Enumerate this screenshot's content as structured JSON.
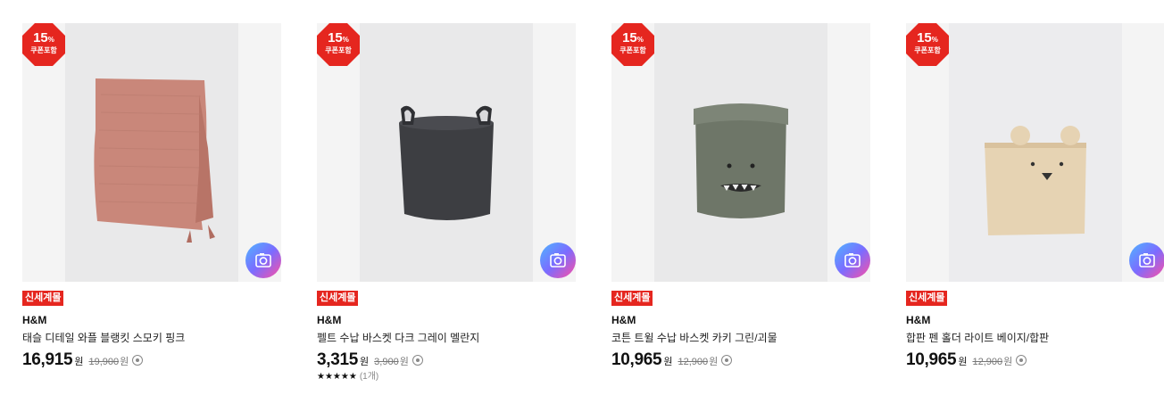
{
  "products": [
    {
      "discount_pct": "15",
      "discount_unit": "%",
      "coupon_label": "쿠폰포함",
      "tag": "신세계몰",
      "brand": "H&M",
      "name": "태슬 디테일 와플 블랭킷 스모키 핑크",
      "price": "16,915",
      "price_unit": "원",
      "original_price": "19,900",
      "original_unit": "원",
      "image": "pink-waffle-blanket-icon"
    },
    {
      "discount_pct": "15",
      "discount_unit": "%",
      "coupon_label": "쿠폰포함",
      "tag": "신세계몰",
      "brand": "H&M",
      "name": "펠트 수납 바스켓 다크 그레이 멜란지",
      "price": "3,315",
      "price_unit": "원",
      "original_price": "3,900",
      "original_unit": "원",
      "rating_stars": "★★★★★",
      "rating_count": "(1개)",
      "image": "felt-basket-icon"
    },
    {
      "discount_pct": "15",
      "discount_unit": "%",
      "coupon_label": "쿠폰포함",
      "tag": "신세계몰",
      "brand": "H&M",
      "name": "코튼 트윌 수납 바스켓 카키 그린/괴물",
      "price": "10,965",
      "price_unit": "원",
      "original_price": "12,900",
      "original_unit": "원",
      "image": "khaki-monster-basket-icon"
    },
    {
      "discount_pct": "15",
      "discount_unit": "%",
      "coupon_label": "쿠폰포함",
      "tag": "신세계몰",
      "brand": "H&M",
      "name": "합판 펜 홀더 라이트 베이지/합판",
      "price": "10,965",
      "price_unit": "원",
      "original_price": "12,900",
      "original_unit": "원",
      "image": "bear-pen-holder-icon"
    }
  ],
  "colors": {
    "badge_red": "#e5261f",
    "tag_red": "#e5261f",
    "camera_gradient": [
      "#4fb6ff",
      "#7b6cff",
      "#ff4fa3"
    ]
  },
  "icons": {
    "camera": "camera-search-icon",
    "info": "info-circle-icon"
  }
}
